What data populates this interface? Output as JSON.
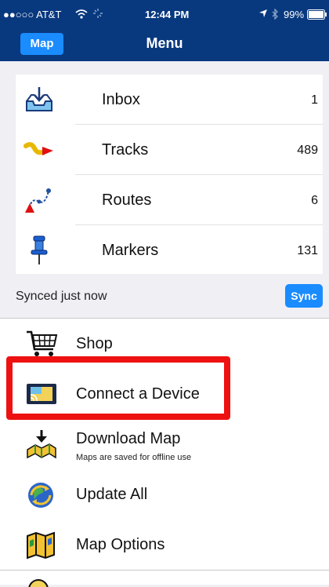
{
  "status": {
    "carrier": "●●○○○ AT&T",
    "time": "12:44 PM",
    "battery": "99%"
  },
  "nav": {
    "map_label": "Map",
    "title": "Menu"
  },
  "primary": [
    {
      "label": "Inbox",
      "count": "1",
      "icon": "inbox-icon"
    },
    {
      "label": "Tracks",
      "count": "489",
      "icon": "tracks-icon"
    },
    {
      "label": "Routes",
      "count": "6",
      "icon": "routes-icon"
    },
    {
      "label": "Markers",
      "count": "131",
      "icon": "marker-pin-icon"
    }
  ],
  "sync": {
    "status_text": "Synced just now",
    "button_label": "Sync"
  },
  "secondary": [
    {
      "label": "Shop",
      "icon": "shopping-cart-icon"
    },
    {
      "label": "Connect a Device",
      "icon": "device-icon"
    },
    {
      "label": "Download Map",
      "subtitle": "Maps are saved for offline use",
      "icon": "download-map-icon"
    },
    {
      "label": "Update All",
      "icon": "update-globe-icon"
    },
    {
      "label": "Map Options",
      "icon": "map-options-icon"
    }
  ],
  "colors": {
    "nav_bg": "#08397f",
    "accent": "#1a8cff",
    "highlight": "#ee1111"
  }
}
